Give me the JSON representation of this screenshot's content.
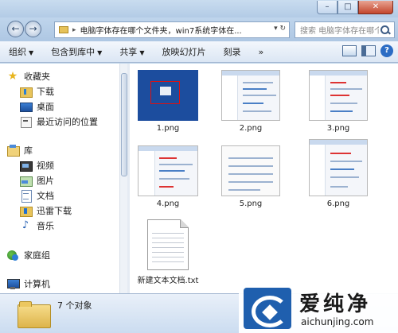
{
  "window": {
    "min_glyph": "–",
    "max_glyph": "□",
    "close_glyph": "✕"
  },
  "address": {
    "path": "电脑字体存在哪个文件夹，win7系统字体在...",
    "search_placeholder": "搜索 电脑字体存在哪个文件..."
  },
  "toolbar": {
    "organize": "组织",
    "include_in_library": "包含到库中",
    "share": "共享",
    "slideshow": "放映幻灯片",
    "burn": "刻录",
    "more": "»"
  },
  "sidebar": {
    "favorites": "收藏夹",
    "downloads": "下载",
    "desktop": "桌面",
    "recent": "最近访问的位置",
    "libraries": "库",
    "videos": "视频",
    "pictures": "图片",
    "documents": "文档",
    "xunlei": "迅雷下载",
    "music": "音乐",
    "homegroup": "家庭组",
    "computer": "计算机"
  },
  "files": [
    {
      "name": "1.png"
    },
    {
      "name": "2.png"
    },
    {
      "name": "3.png"
    },
    {
      "name": "4.png"
    },
    {
      "name": "5.png"
    },
    {
      "name": "6.png"
    },
    {
      "name": "新建文本文档.txt"
    }
  ],
  "status": {
    "count_text": "7 个对象"
  },
  "watermark": {
    "title": "爱纯净",
    "url": "aichunjing.com"
  },
  "icons": [
    "back-icon",
    "forward-icon",
    "folder-icon",
    "search-icon",
    "view-icon",
    "preview-pane-icon",
    "help-icon",
    "star-icon",
    "download-icon",
    "desktop-icon",
    "recent-icon",
    "library-icon",
    "video-icon",
    "picture-icon",
    "document-icon",
    "music-icon",
    "homegroup-icon",
    "computer-icon"
  ]
}
